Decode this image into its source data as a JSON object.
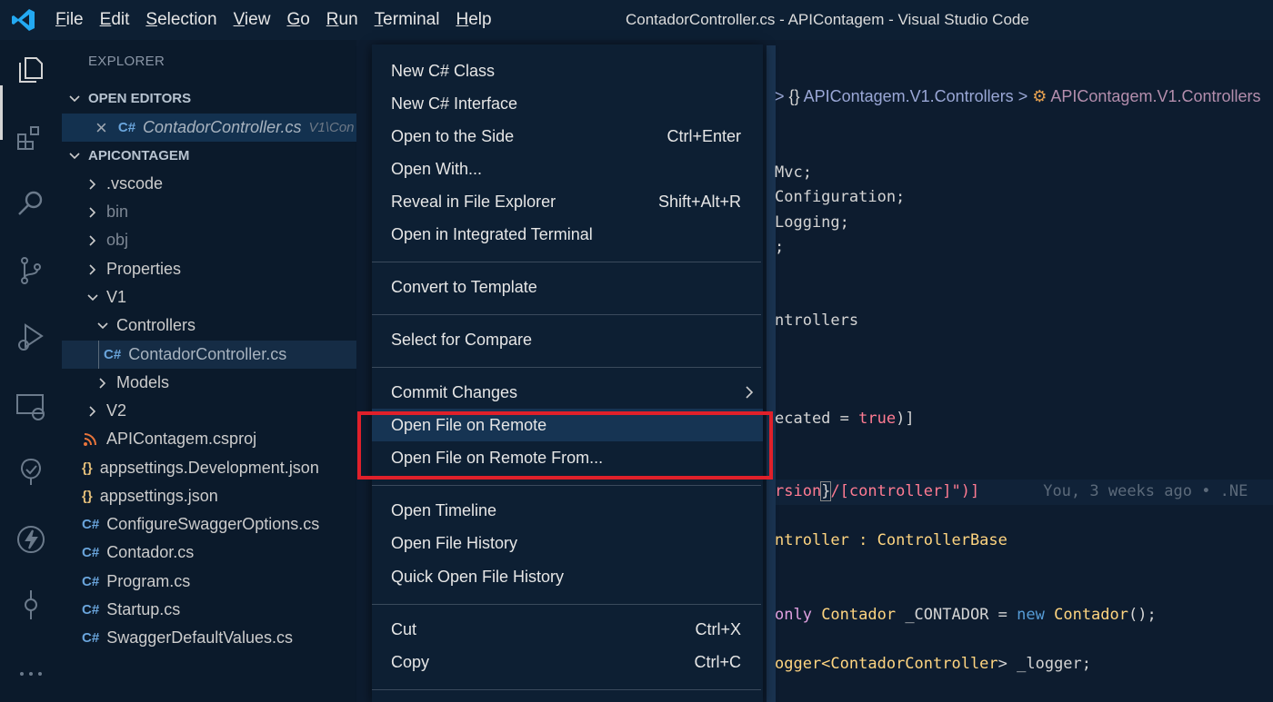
{
  "titlebar": {
    "menus": [
      "File",
      "Edit",
      "Selection",
      "View",
      "Go",
      "Run",
      "Terminal",
      "Help"
    ],
    "title": "ContadorController.cs - APIContagem - Visual Studio Code"
  },
  "sidebar": {
    "title": "EXPLORER",
    "open_editors_label": "OPEN EDITORS",
    "open_editor": {
      "close": "×",
      "icon": "C#",
      "name": "ContadorController.cs",
      "desc": "V1\\Con"
    },
    "project_label": "APICONTAGEM",
    "folders": {
      "vscode": ".vscode",
      "bin": "bin",
      "obj": "obj",
      "properties": "Properties",
      "v1": "V1",
      "controllers": "Controllers",
      "active_file": "ContadorController.cs",
      "models": "Models",
      "v2": "V2"
    },
    "files": [
      {
        "icon": "rss",
        "name": "APIContagem.csproj"
      },
      {
        "icon": "{}",
        "name": "appsettings.Development.json"
      },
      {
        "icon": "{}",
        "name": "appsettings.json"
      },
      {
        "icon": "C#",
        "name": "ConfigureSwaggerOptions.cs"
      },
      {
        "icon": "C#",
        "name": "Contador.cs"
      },
      {
        "icon": "C#",
        "name": "Program.cs"
      },
      {
        "icon": "C#",
        "name": "Startup.cs"
      },
      {
        "icon": "C#",
        "name": "SwaggerDefaultValues.cs"
      }
    ],
    "csharp_icon": "C#"
  },
  "editor": {
    "breadcrumb": {
      "sep1": ">",
      "ns_icon": "{}",
      "namespace": "APIContagem.V1.Controllers",
      "sep2": ">",
      "class_icon": "⚙",
      "class": "APIContagem.V1.Controllers"
    },
    "code": {
      "l1": "Mvc;",
      "l2": "Configuration;",
      "l3": "Logging;",
      "l4": ";",
      "l5": "ntrollers",
      "l6a": "ecated = ",
      "l6b": "true",
      "l6c": ")]",
      "l7a": "rsion",
      "l7b": "}",
      "l7c": "/[controller]\")]",
      "l7blame": "You, 3 weeks ago • .NE",
      "l8a": "ntroller : ",
      "l8b": "ControllerBase",
      "l9a": "only ",
      "l9b": "Contador",
      "l9c": " _CONTADOR = ",
      "l9d": "new",
      "l9e": " ",
      "l9f": "Contador",
      "l9g": "();",
      "l10a": "ogger<",
      "l10b": "ContadorController",
      "l10c": "> _logger;"
    }
  },
  "context_menu": {
    "items": [
      {
        "label": "New C# Class",
        "key": ""
      },
      {
        "label": "New C# Interface",
        "key": ""
      },
      {
        "label": "Open to the Side",
        "key": "Ctrl+Enter"
      },
      {
        "label": "Open With...",
        "key": ""
      },
      {
        "label": "Reveal in File Explorer",
        "key": "Shift+Alt+R"
      },
      {
        "label": "Open in Integrated Terminal",
        "key": ""
      },
      {
        "label": "Convert to Template",
        "key": ""
      },
      {
        "label": "Select for Compare",
        "key": ""
      },
      {
        "label": "Commit Changes",
        "key": ""
      },
      {
        "label": "Open File on Remote",
        "key": ""
      },
      {
        "label": "Open File on Remote From...",
        "key": ""
      },
      {
        "label": "Open Timeline",
        "key": ""
      },
      {
        "label": "Open File History",
        "key": ""
      },
      {
        "label": "Quick Open File History",
        "key": ""
      },
      {
        "label": "Cut",
        "key": "Ctrl+X"
      },
      {
        "label": "Copy",
        "key": "Ctrl+C"
      }
    ]
  },
  "colors": {
    "background": "#0b1a2b",
    "highlight_box": "#e0202a",
    "csharp_icon": "#6aa5dc",
    "json_icon": "#e5c07b",
    "rss_icon": "#e8743b"
  },
  "activity_icons": [
    "explorer-icon",
    "extensions-icon",
    "search-icon",
    "source-control-icon",
    "run-debug-icon",
    "remote-explorer-icon",
    "testing-icon",
    "thunder-client-icon",
    "git-commit-icon",
    "more-icon"
  ]
}
